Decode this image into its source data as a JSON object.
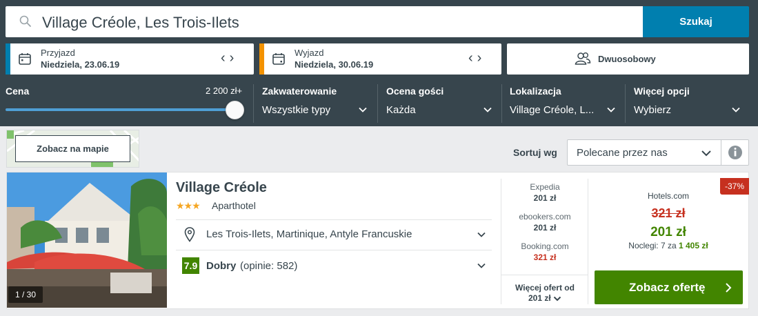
{
  "search": {
    "query": "Village Créole, Les Trois-Ilets",
    "button": "Szukaj"
  },
  "dates": {
    "checkin_label": "Przyjazd",
    "checkin_value": "Niedziela, 23.06.19",
    "checkout_label": "Wyjazd",
    "checkout_value": "Niedziela, 30.06.19",
    "prev": "‹",
    "next": "›"
  },
  "room": {
    "label": "Dwuosobowy"
  },
  "filters": {
    "price": {
      "label": "Cena",
      "max": "2 200 zł+"
    },
    "accommodation": {
      "label": "Zakwaterowanie",
      "value": "Wszystkie typy"
    },
    "guest_rating": {
      "label": "Ocena gości",
      "value": "Każda"
    },
    "location": {
      "label": "Lokalizacja",
      "value": "Village Créole, L..."
    },
    "more": {
      "label": "Więcej opcji",
      "value": "Wybierz"
    }
  },
  "map": {
    "button": "Zobacz na mapie"
  },
  "sort": {
    "label": "Sortuj wg",
    "value": "Polecane przez nas"
  },
  "hotel": {
    "name": "Village Créole",
    "stars": "★★★",
    "type": "Aparthotel",
    "location": "Les Trois-Ilets, Martinique, Antyle Francuskie",
    "rating_score": "7.9",
    "rating_word": "Dobry",
    "rating_count": "(opinie: 582)",
    "photo_counter": "1 / 30"
  },
  "partners": [
    {
      "name": "Expedia",
      "price": "201 zł"
    },
    {
      "name": "ebookers.com",
      "price": "201 zł"
    },
    {
      "name": "Booking.com",
      "price": "321 zł"
    }
  ],
  "more_offers": {
    "line1": "Więcej ofert od",
    "line2": "201 zł"
  },
  "deal": {
    "discount": "-37%",
    "provider": "Hotels.com",
    "old_price": "321 zł",
    "new_price": "201 zł",
    "nights_prefix": "Noclegi: 7 za",
    "nights_total": "1 405 zł",
    "cta": "Zobacz ofertę"
  },
  "colors": {
    "header_bg": "#37454d",
    "accent_blue": "#007faf",
    "checkout_orange": "#f39200",
    "deal_green": "#428500",
    "discount_red": "#c6301f"
  },
  "price_slider_fraction": 1.0
}
